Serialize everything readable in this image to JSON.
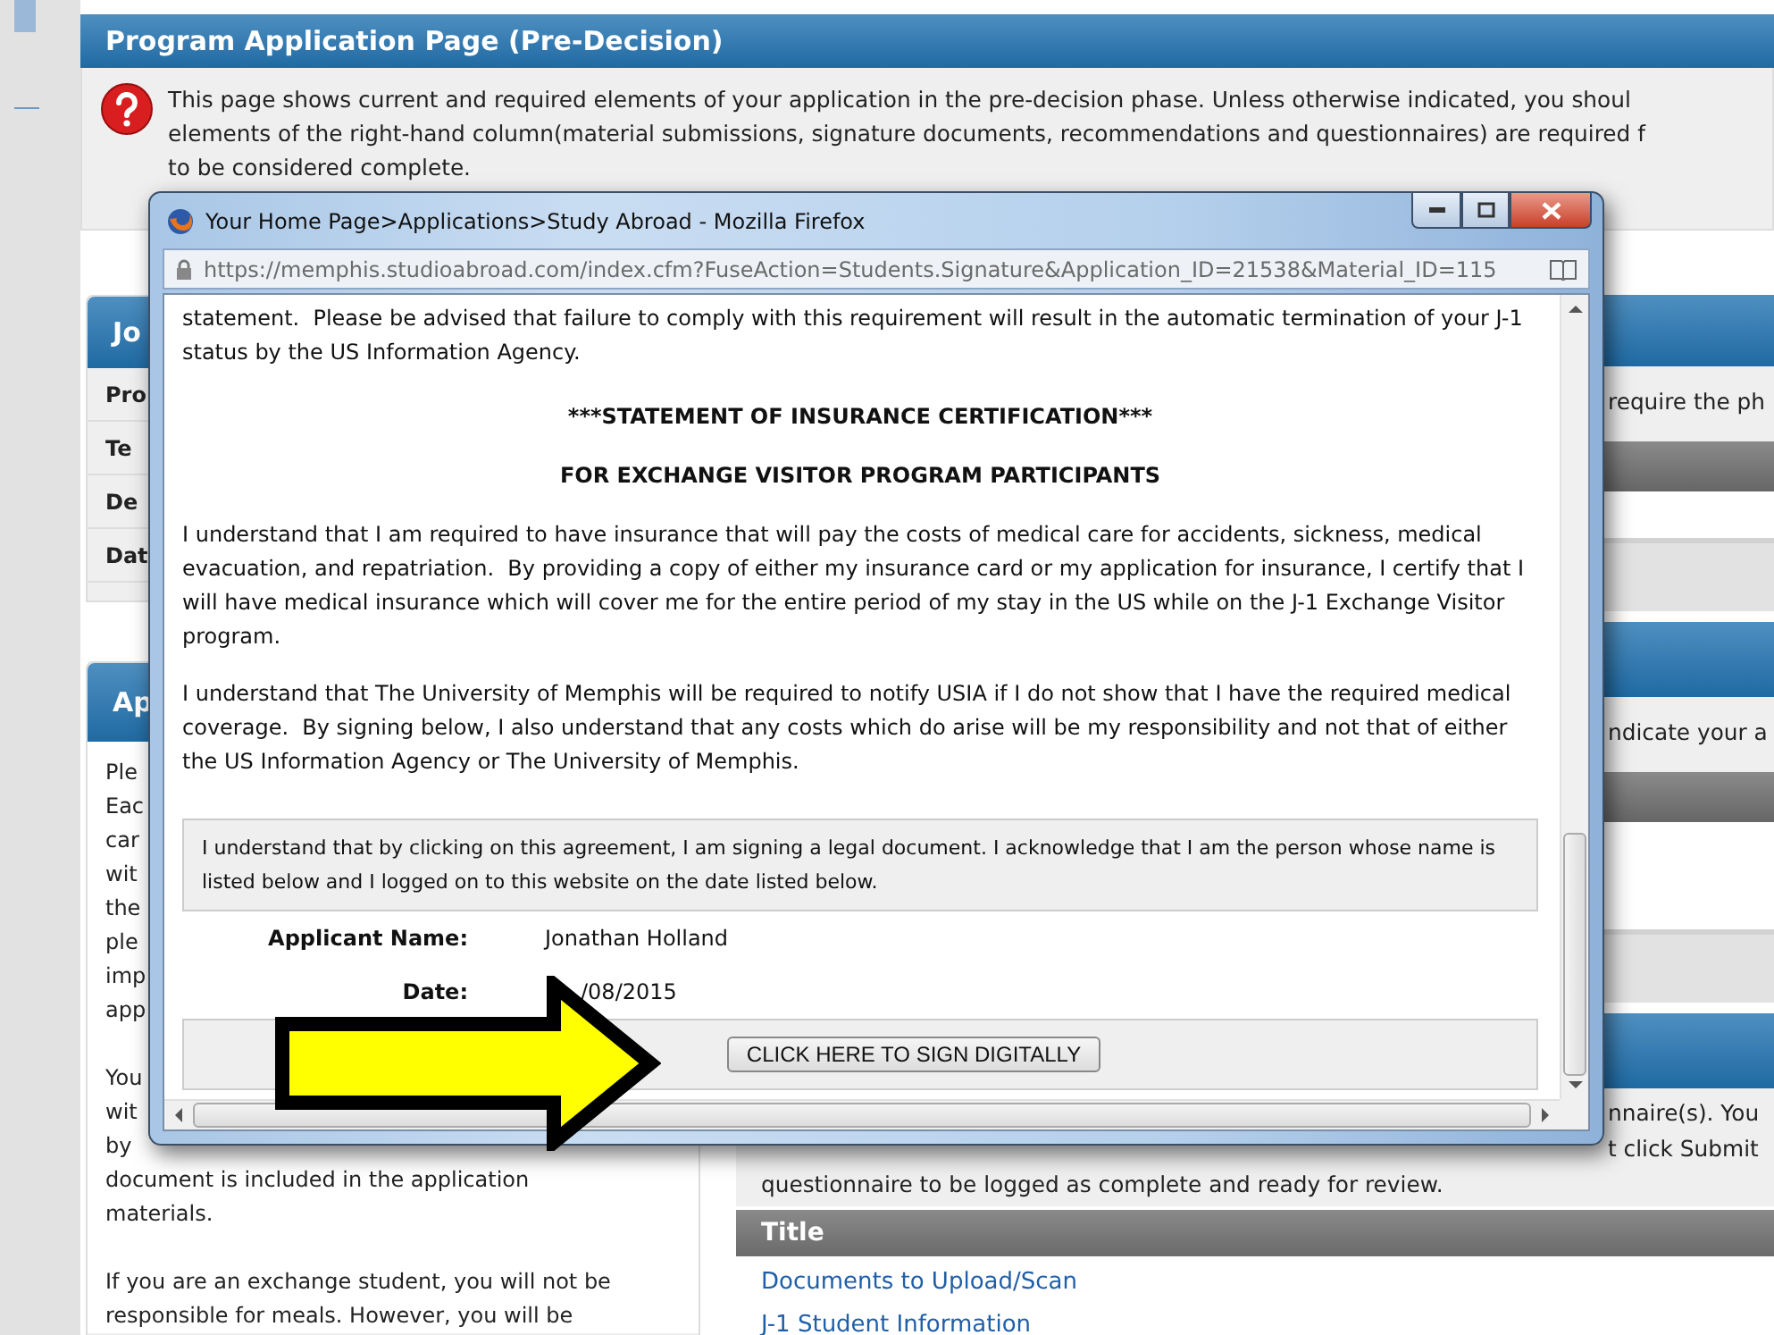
{
  "page": {
    "title": "Program Application Page (Pre-Decision)",
    "notice": [
      "This page shows current and required elements of your application in the pre-decision phase. Unless otherwise indicated, you shoul",
      "elements of the right-hand column(material submissions, signature documents, recommendations and questionnaires) are required f",
      "to be considered complete."
    ]
  },
  "left_panels": [
    {
      "header": "Jo",
      "rows": [
        "Pro",
        "Te",
        "De",
        "Dat"
      ]
    },
    {
      "header": "Ap",
      "paragraphs": [
        [
          "Ple",
          "Eac",
          "car",
          "wit",
          "the",
          "ple",
          "imp",
          "app"
        ],
        [
          "You",
          "wit",
          "by",
          "document is included in the application",
          "materials."
        ],
        [
          "If you are an exchange student, you will not be",
          "responsible for meals. However, you will be"
        ]
      ]
    }
  ],
  "right_panel": {
    "sections": [
      {
        "lines": [
          {
            "kind": "fragment",
            "text": "require the ph"
          }
        ]
      },
      {
        "lines": [
          {
            "kind": "fragment",
            "text": "ndicate your a"
          }
        ]
      },
      {
        "lines": [
          {
            "kind": "fragment",
            "text": "nnaire(s). You"
          },
          {
            "kind": "fragment",
            "text": "t click Submit"
          },
          {
            "kind": "full",
            "text": "questionnaire to be logged as complete and ready for review."
          }
        ]
      }
    ],
    "table": {
      "column": "Title",
      "rows": [
        "Documents to Upload/Scan",
        "J-1 Student Information"
      ]
    }
  },
  "popup": {
    "title": "Your Home Page>Applications>Study Abroad - Mozilla Firefox",
    "url": "https://memphis.studioabroad.com/index.cfm?FuseAction=Students.Signature&Application_ID=21538&Material_ID=115",
    "intro": "statement.  Please be advised that failure to comply with this requirement will result in the automatic termination of your J-1 status by the US Information Agency.",
    "headings": [
      "***STATEMENT OF INSURANCE CERTIFICATION***",
      "FOR EXCHANGE VISITOR PROGRAM PARTICIPANTS"
    ],
    "paragraphs": [
      "I understand that I am required to have insurance that will pay the costs of medical care for accidents, sickness, medical evacuation, and repatriation.  By providing a copy of either my insurance card or my application for insurance, I certify that I will have medical insurance which will cover me for the entire period of my stay in the US while on the J-1 Exchange Visitor program.",
      "I understand that The University of Memphis will be required to notify USIA if I do not show that I have the required medical coverage.  By signing below, I also understand that any costs which do arise will be my responsibility and not that of either the US Information Agency or The University of Memphis."
    ],
    "agreement": "I understand that by clicking on this agreement, I am signing a legal document. I acknowledge that I am the person whose name is listed below and I logged on to this website on the date listed below.",
    "fields": [
      {
        "label": "Applicant Name:",
        "value": "Jonathan Holland"
      },
      {
        "label": "Date:",
        "value": "/08/2015"
      }
    ],
    "sign_button": "CLICK HERE TO SIGN DIGITALLY"
  }
}
